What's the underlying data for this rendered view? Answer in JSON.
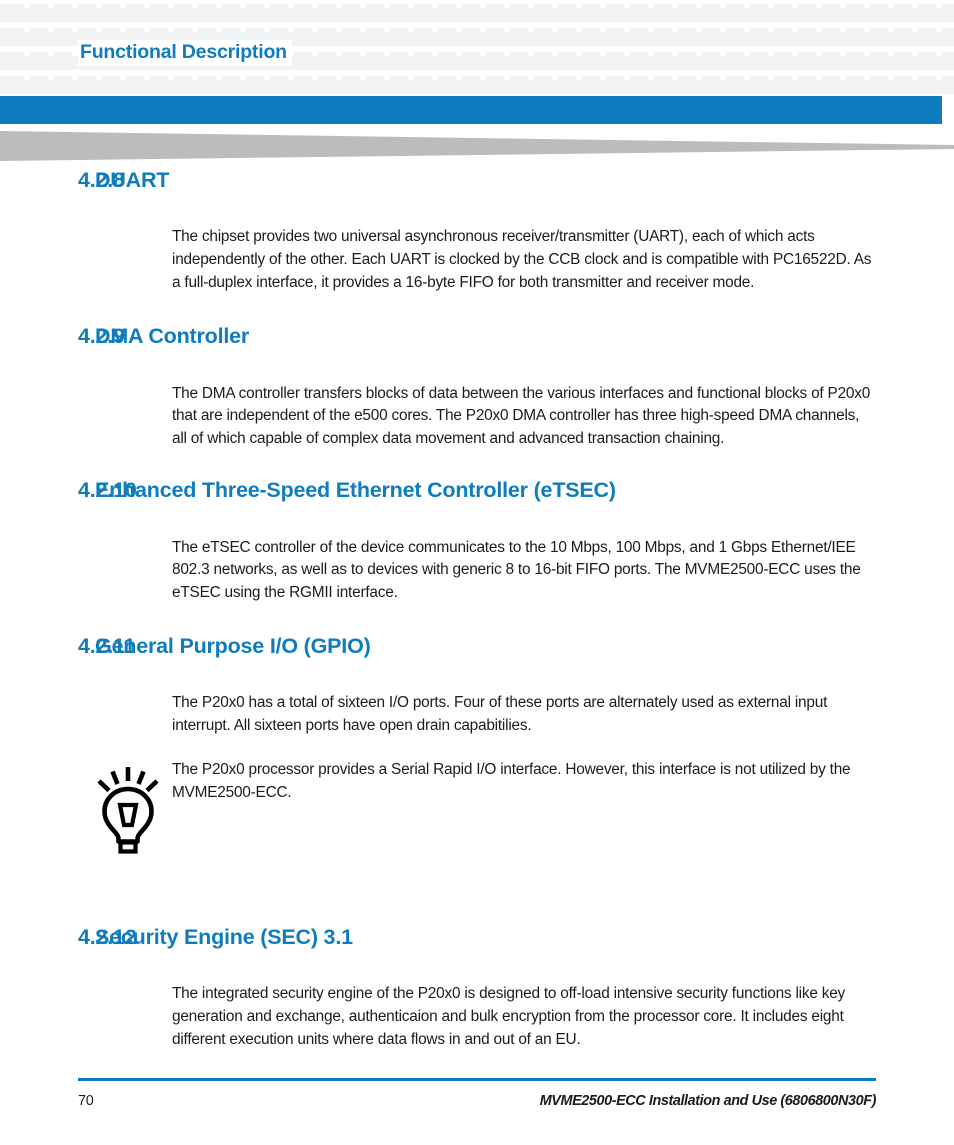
{
  "header": {
    "running_title": "Functional Description",
    "accent_color": "#0C7CBE",
    "pattern_square_color": "#f2f3f4",
    "wedge_color": "#bcbcbc"
  },
  "sections": [
    {
      "number": "4.2.8",
      "title": "DUART",
      "body": "The chipset provides two universal asynchronous receiver/transmitter (UART), each of which acts independently of the other. Each UART is clocked by the CCB clock and is compatible with PC16522D. As a full-duplex interface, it provides a 16-byte FIFO for both transmitter and receiver mode."
    },
    {
      "number": "4.2.9",
      "title": "DMA Controller",
      "body": "The DMA controller transfers blocks of data between the various interfaces and functional blocks of P20x0 that are independent of the e500 cores. The P20x0 DMA controller has three high-speed DMA  channels, all of which capable of complex data movement and advanced transaction chaining."
    },
    {
      "number": "4.2.10",
      "title": "Enhanced Three-Speed Ethernet Controller (eTSEC)",
      "body": "The eTSEC controller of the device communicates to the 10 Mbps, 100 Mbps, and 1 Gbps Ethernet/IEE 802.3 networks, as well as to devices with generic 8 to 16-bit FIFO ports. The MVME2500-ECC uses the eTSEC using the RGMII interface."
    },
    {
      "number": "4.2.11",
      "title": "General Purpose I/O (GPIO)",
      "body": "The P20x0 has a total of sixteen I/O ports. Four of these ports are alternately used as external input interrupt. All sixteen ports have open drain capabitilies."
    },
    {
      "number": "4.2.12",
      "title": "Security Engine (SEC) 3.1",
      "body": "The integrated security engine of the P20x0 is designed to off-load intensive security functions like key generation and exchange, authenticaion and bulk encryption from the processor core. It includes eight different execution units where data flows in and out of an EU."
    }
  ],
  "tip": {
    "icon": "lightbulb-tip-icon",
    "text": "The P20x0 processor provides a Serial Rapid I/O interface. However, this interface is not utilized by the MVME2500-ECC."
  },
  "footer": {
    "page_number": "70",
    "document_title": "MVME2500-ECC Installation and Use (6806800N30F)",
    "rule_color": "#0C7CBE"
  }
}
